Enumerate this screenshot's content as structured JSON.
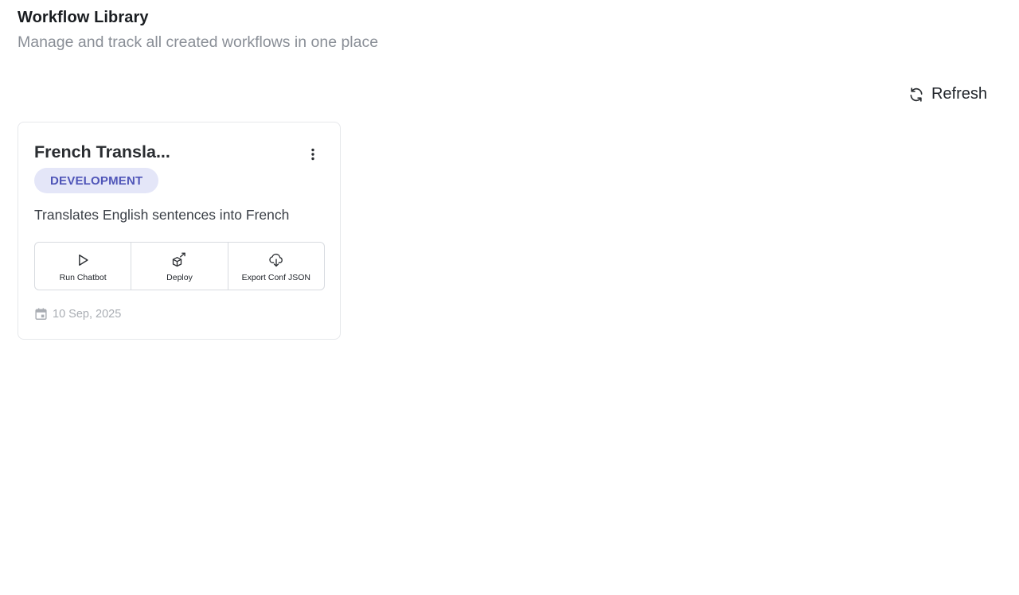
{
  "header": {
    "title": "Workflow Library",
    "subtitle": "Manage and track all created workflows in one place"
  },
  "toolbar": {
    "refresh_label": "Refresh",
    "refresh_icon": "refresh-icon"
  },
  "workflows": [
    {
      "title": "French Transla...",
      "status": "DEVELOPMENT",
      "description": "Translates English sentences into French",
      "date": "10 Sep, 2025",
      "actions": [
        {
          "label": "Run Chatbot",
          "icon": "play-icon"
        },
        {
          "label": "Deploy",
          "icon": "deploy-box-icon"
        },
        {
          "label": "Export Conf JSON",
          "icon": "cloud-download-icon"
        }
      ]
    }
  ],
  "colors": {
    "badge_bg": "#e4e6f8",
    "badge_text": "#4f55b8",
    "muted_text": "#8a8f97"
  }
}
